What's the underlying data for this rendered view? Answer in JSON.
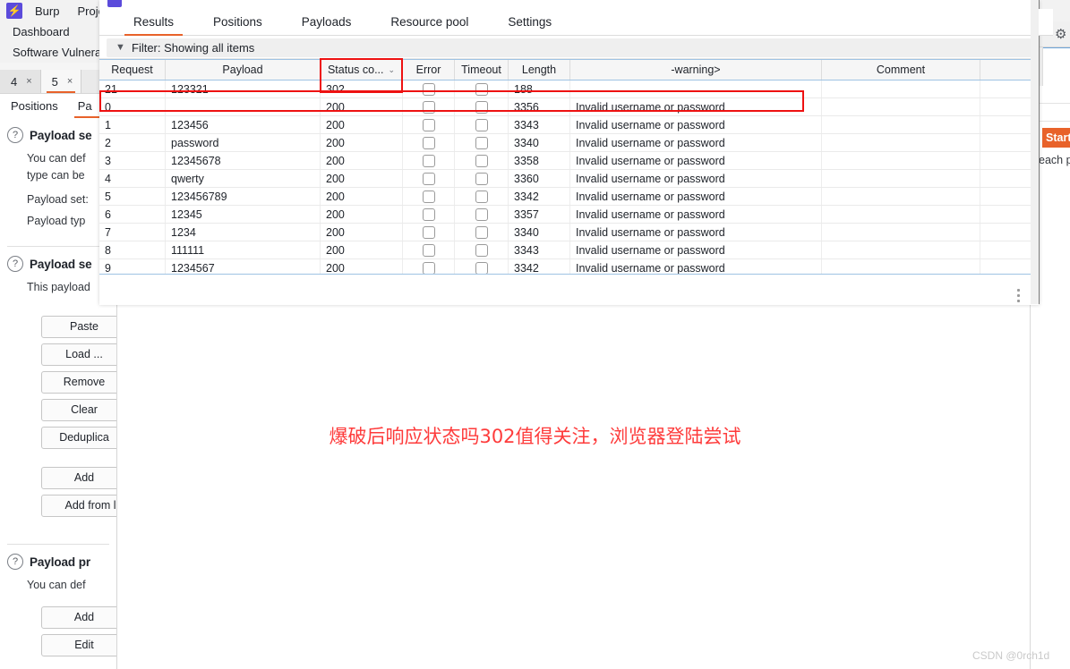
{
  "background": {
    "menubar": {
      "logo_label": "⚡",
      "items": [
        "Burp",
        "Proje"
      ]
    },
    "nav_items": [
      "Dashboard",
      "Software Vulnera"
    ],
    "attack_tabs": [
      {
        "label": "4",
        "close": "×",
        "active": false
      },
      {
        "label": "5",
        "close": "×",
        "active": true
      }
    ],
    "sub_tabs": [
      {
        "label": "Positions",
        "active": false
      },
      {
        "label": "Pa",
        "active": true
      }
    ],
    "sections": [
      {
        "help_icon": "?",
        "title": "Payload se",
        "desc_lines": [
          "You can def",
          "type can be"
        ],
        "fields": [
          "Payload set:",
          "Payload typ"
        ],
        "buttons": []
      },
      {
        "help_icon": "?",
        "title": "Payload se",
        "desc_lines": [
          "This payload"
        ],
        "fields": [],
        "buttons": [
          "Paste",
          "Load ...",
          "Remove",
          "Clear",
          "Deduplica",
          "Add",
          "Add from l"
        ]
      },
      {
        "help_icon": "?",
        "title": "Payload pr",
        "desc_lines": [
          "You can def"
        ],
        "fields": [],
        "buttons": [
          "Add",
          "Edit"
        ]
      }
    ],
    "right_panel": {
      "gear_icon": "⚙",
      "start_attack_label": "Start a",
      "hint_text": "each pa"
    }
  },
  "attack_window": {
    "tabs": [
      {
        "label": "Results",
        "active": true
      },
      {
        "label": "Positions",
        "active": false
      },
      {
        "label": "Payloads",
        "active": false
      },
      {
        "label": "Resource pool",
        "active": false
      },
      {
        "label": "Settings",
        "active": false
      }
    ],
    "filter": {
      "icon": "filter-icon",
      "text": "Filter: Showing all items"
    },
    "table": {
      "columns": [
        {
          "key": "request",
          "label": "Request"
        },
        {
          "key": "payload",
          "label": "Payload"
        },
        {
          "key": "status",
          "label": "Status co...",
          "sorted": true,
          "caret": "⌄"
        },
        {
          "key": "error",
          "label": "Error"
        },
        {
          "key": "timeout",
          "label": "Timeout"
        },
        {
          "key": "length",
          "label": "Length"
        },
        {
          "key": "warning",
          "label": "-warning>"
        },
        {
          "key": "comment",
          "label": "Comment"
        },
        {
          "key": "spacer",
          "label": ""
        }
      ],
      "rows": [
        {
          "request": "21",
          "payload": "123321",
          "status": "302",
          "error": false,
          "timeout": false,
          "length": "188",
          "warning": "",
          "comment": "",
          "highlight": true
        },
        {
          "request": "0",
          "payload": "",
          "status": "200",
          "error": false,
          "timeout": false,
          "length": "3356",
          "warning": "Invalid username or password",
          "comment": "",
          "highlight": false
        },
        {
          "request": "1",
          "payload": "123456",
          "status": "200",
          "error": false,
          "timeout": false,
          "length": "3343",
          "warning": "Invalid username or password",
          "comment": "",
          "highlight": false
        },
        {
          "request": "2",
          "payload": "password",
          "status": "200",
          "error": false,
          "timeout": false,
          "length": "3340",
          "warning": "Invalid username or password",
          "comment": "",
          "highlight": false
        },
        {
          "request": "3",
          "payload": "12345678",
          "status": "200",
          "error": false,
          "timeout": false,
          "length": "3358",
          "warning": "Invalid username or password",
          "comment": "",
          "highlight": false
        },
        {
          "request": "4",
          "payload": "qwerty",
          "status": "200",
          "error": false,
          "timeout": false,
          "length": "3360",
          "warning": "Invalid username or password",
          "comment": "",
          "highlight": false
        },
        {
          "request": "5",
          "payload": "123456789",
          "status": "200",
          "error": false,
          "timeout": false,
          "length": "3342",
          "warning": "Invalid username or password",
          "comment": "",
          "highlight": false
        },
        {
          "request": "6",
          "payload": "12345",
          "status": "200",
          "error": false,
          "timeout": false,
          "length": "3357",
          "warning": "Invalid username or password",
          "comment": "",
          "highlight": false
        },
        {
          "request": "7",
          "payload": "1234",
          "status": "200",
          "error": false,
          "timeout": false,
          "length": "3340",
          "warning": "Invalid username or password",
          "comment": "",
          "highlight": false
        },
        {
          "request": "8",
          "payload": "111111",
          "status": "200",
          "error": false,
          "timeout": false,
          "length": "3343",
          "warning": "Invalid username or password",
          "comment": "",
          "highlight": false
        },
        {
          "request": "9",
          "payload": "1234567",
          "status": "200",
          "error": false,
          "timeout": false,
          "length": "3342",
          "warning": "Invalid username or password",
          "comment": "",
          "highlight": false
        }
      ]
    }
  },
  "annotations": {
    "note_text": "爆破后响应状态吗302值得关注，浏览器登陆尝试",
    "note_color": "#fe3b3b",
    "box_color": "#ee1111"
  },
  "watermark": {
    "text": "CSDN @0rch1d"
  }
}
